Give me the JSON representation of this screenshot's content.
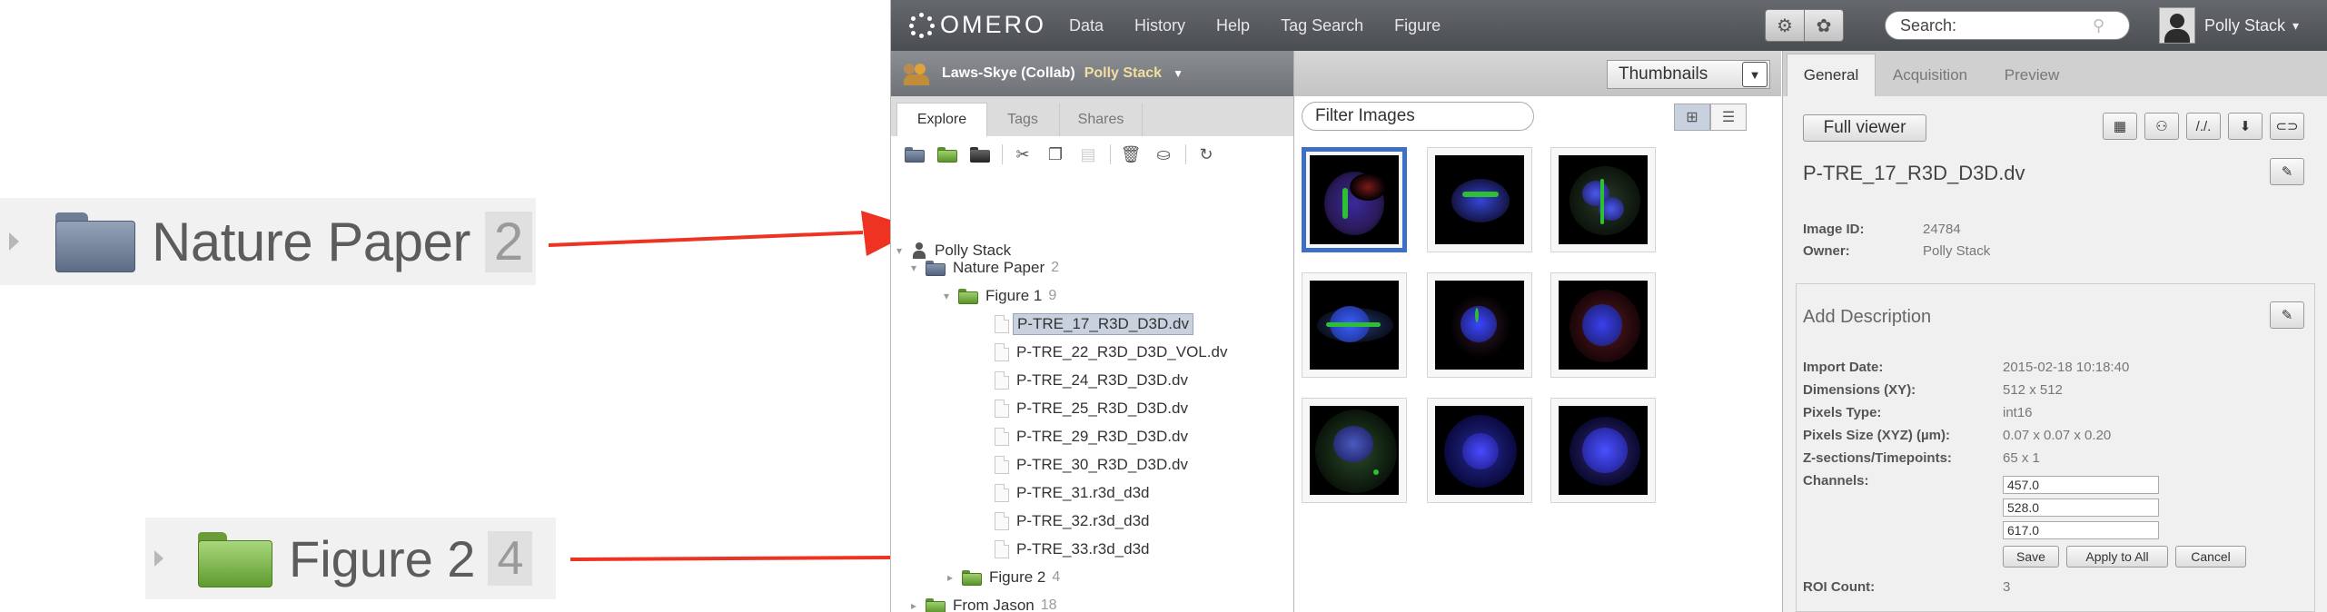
{
  "zoom_callouts": {
    "project": {
      "name": "Nature Paper",
      "count": "2"
    },
    "dataset": {
      "name": "Figure 2",
      "count": "4"
    }
  },
  "colors": {
    "arrow": "#ee3322",
    "selection": "#3d6fc9",
    "topbar": "#55585d"
  },
  "app": {
    "logo": "OMERO",
    "nav": [
      "Data",
      "History",
      "Help",
      "Tag Search",
      "Figure"
    ],
    "toolbar_icons": [
      "settings-icon",
      "webclient-icon"
    ],
    "search_placeholder": "Search:",
    "user_name": "Polly Stack"
  },
  "left_panel": {
    "group_name": "Laws-Skye (Collab)",
    "group_user": "Polly Stack",
    "tabs": [
      "Explore",
      "Tags",
      "Shares"
    ],
    "toolbar_icons": [
      "new-project-icon",
      "new-dataset-icon",
      "new-screen-icon",
      "cut-icon",
      "copy-icon",
      "paste-icon",
      "delete-icon",
      "basket-icon",
      "refresh-icon"
    ],
    "tree": {
      "root": "Polly Stack",
      "project": {
        "name": "Nature Paper",
        "count": "2"
      },
      "dataset1": {
        "name": "Figure 1",
        "count": "9"
      },
      "images": [
        "P-TRE_17_R3D_D3D.dv",
        "P-TRE_22_R3D_D3D_VOL.dv",
        "P-TRE_24_R3D_D3D.dv",
        "P-TRE_25_R3D_D3D.dv",
        "P-TRE_29_R3D_D3D.dv",
        "P-TRE_30_R3D_D3D.dv",
        "P-TRE_31.r3d_d3d",
        "P-TRE_32.r3d_d3d",
        "P-TRE_33.r3d_d3d"
      ],
      "dataset2": {
        "name": "Figure 2",
        "count": "4"
      },
      "project2": {
        "name": "From Jason",
        "count": "18"
      }
    }
  },
  "center_panel": {
    "view_select": "Thumbnails",
    "filter_placeholder": "Filter Images",
    "view_buttons": [
      "grid-view-icon",
      "list-view-icon"
    ],
    "thumbnail_count": 9
  },
  "right_panel": {
    "tabs": [
      "General",
      "Acquisition",
      "Preview"
    ],
    "full_viewer": "Full viewer",
    "action_icons": [
      "split-view-icon",
      "hierarchy-icon",
      "path-icon",
      "download-icon",
      "link-icon"
    ],
    "image_name": "P-TRE_17_R3D_D3D.dv",
    "image_id_label": "Image ID:",
    "image_id": "24784",
    "owner_label": "Owner:",
    "owner": "Polly Stack",
    "add_description": "Add Description",
    "details": [
      {
        "k": "Import Date:",
        "v": "2015-02-18 10:18:40"
      },
      {
        "k": "Dimensions (XY):",
        "v": "512 x 512"
      },
      {
        "k": "Pixels Type:",
        "v": "int16"
      },
      {
        "k": "Pixels Size (XYZ) (µm):",
        "v": "0.07 x 0.07 x 0.20"
      },
      {
        "k": "Z-sections/Timepoints:",
        "v": "65 x 1"
      }
    ],
    "channels_label": "Channels:",
    "channels": [
      "457.0",
      "528.0",
      "617.0"
    ],
    "buttons": {
      "save": "Save",
      "apply_all": "Apply to All",
      "cancel": "Cancel"
    },
    "roi_label": "ROI Count:",
    "roi_count": "3"
  }
}
